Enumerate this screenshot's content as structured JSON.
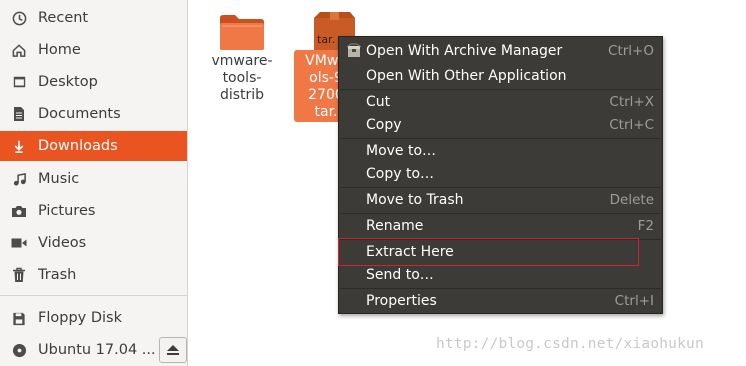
{
  "sidebar": {
    "items": [
      {
        "label": "Recent",
        "icon": "clock-icon"
      },
      {
        "label": "Home",
        "icon": "home-icon"
      },
      {
        "label": "Desktop",
        "icon": "desktop-icon"
      },
      {
        "label": "Documents",
        "icon": "document-icon"
      },
      {
        "label": "Downloads",
        "icon": "download-icon",
        "active": true
      },
      {
        "label": "Music",
        "icon": "music-icon"
      },
      {
        "label": "Pictures",
        "icon": "camera-icon"
      },
      {
        "label": "Videos",
        "icon": "video-icon"
      },
      {
        "label": "Trash",
        "icon": "trash-icon"
      }
    ],
    "devices": [
      {
        "label": "Floppy Disk",
        "icon": "floppy-icon"
      },
      {
        "label": "Ubuntu 17.04 ...",
        "icon": "disc-icon"
      }
    ]
  },
  "files": {
    "folder": {
      "line1": "vmware-",
      "line2": "tools-",
      "line3": "distrib"
    },
    "archive": {
      "icon_text": "tar.",
      "line1": "VMwa",
      "line2": "ols-9",
      "line3": "2700",
      "line4": "tar."
    }
  },
  "context_menu": {
    "items": [
      {
        "label": "Open With Archive Manager",
        "accel": "Ctrl+O"
      },
      {
        "label": "Open With Other Application",
        "accel": ""
      },
      {
        "label": "Cut",
        "accel": "Ctrl+X"
      },
      {
        "label": "Copy",
        "accel": "Ctrl+C"
      },
      {
        "label": "Move to…",
        "accel": ""
      },
      {
        "label": "Copy to…",
        "accel": ""
      },
      {
        "label": "Move to Trash",
        "accel": "Delete"
      },
      {
        "label": "Rename",
        "accel": "F2"
      },
      {
        "label": "Extract Here",
        "accel": ""
      },
      {
        "label": "Send to…",
        "accel": ""
      },
      {
        "label": "Properties",
        "accel": "Ctrl+I"
      }
    ]
  },
  "colors": {
    "accent": "#e95420",
    "menu_bg": "#3c3b37",
    "highlight_border": "#d3202a"
  },
  "watermark": "http://blog.csdn.net/xiaohukun"
}
